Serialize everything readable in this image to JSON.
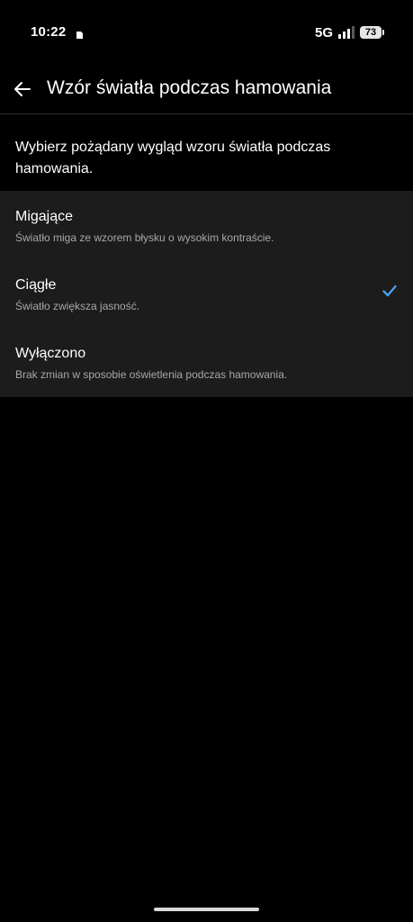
{
  "status_bar": {
    "time": "10:22",
    "network": "5G",
    "battery": "73"
  },
  "header": {
    "title": "Wzór światła podczas hamowania"
  },
  "description": "Wybierz pożądany wygląd wzoru światła podczas hamowania.",
  "options": [
    {
      "title": "Migające",
      "subtitle": "Światło miga ze wzorem błysku o wysokim kontraście.",
      "selected": false
    },
    {
      "title": "Ciągłe",
      "subtitle": "Światło zwiększa jasność.",
      "selected": true
    },
    {
      "title": "Wyłączono",
      "subtitle": "Brak zmian w sposobie oświetlenia podczas hamowania.",
      "selected": false
    }
  ],
  "colors": {
    "background": "#000000",
    "panel": "#1c1c1c",
    "accent": "#4a9fe8",
    "secondary_text": "#a8a8a8"
  },
  "icons": {
    "back": "arrow-left-icon",
    "check": "check-icon",
    "signal": "signal-icon",
    "notification": "notification-icon"
  }
}
